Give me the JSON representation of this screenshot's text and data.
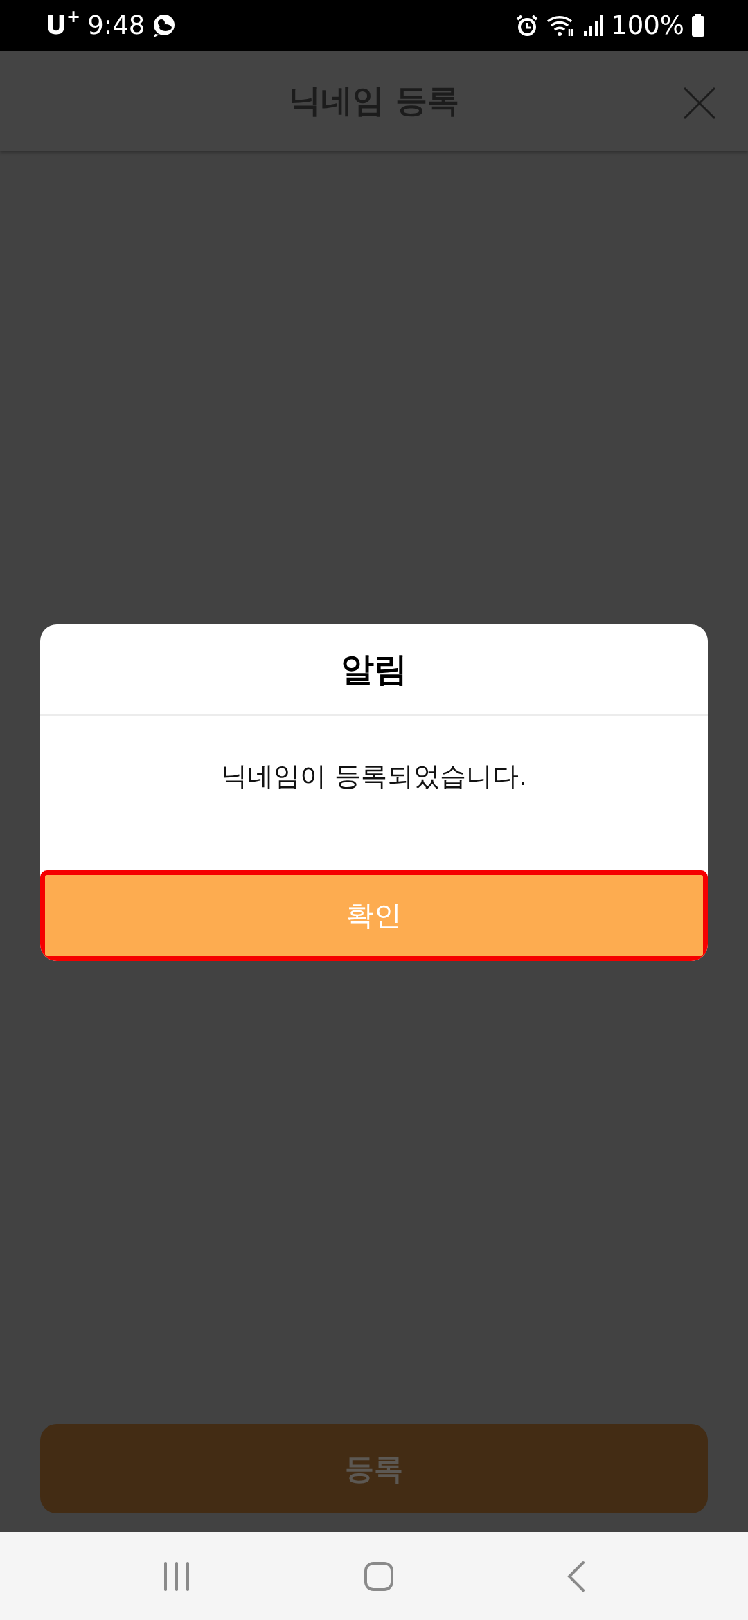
{
  "status_bar": {
    "carrier": "U",
    "carrier_mark": "+",
    "time": "9:48",
    "battery": "100%"
  },
  "header": {
    "title": "닉네임 등록"
  },
  "dialog": {
    "title": "알림",
    "message": "닉네임이 등록되었습니다.",
    "confirm_button": {
      "label": "확인",
      "highlighted": true
    }
  },
  "register_button": {
    "label": "등록",
    "disabled": true
  }
}
